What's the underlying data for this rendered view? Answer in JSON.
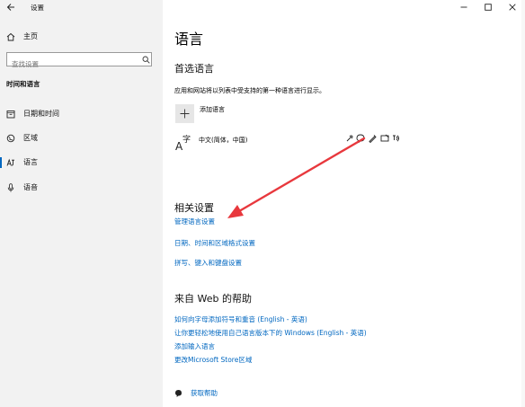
{
  "window": {
    "title": "设置",
    "back_icon": "back-arrow-icon",
    "minimize_icon": "minimize-icon",
    "maximize_icon": "maximize-icon",
    "close_icon": "close-icon"
  },
  "sidebar": {
    "home_label": "主页",
    "search_placeholder": "查找设置",
    "category": "时间和语言",
    "items": [
      {
        "label": "日期和时间",
        "icon": "calendar-icon",
        "selected": false
      },
      {
        "label": "区域",
        "icon": "globe-icon",
        "selected": false
      },
      {
        "label": "语言",
        "icon": "language-icon",
        "selected": true
      },
      {
        "label": "语音",
        "icon": "microphone-icon",
        "selected": false
      }
    ],
    "accent_color": "#0067c0"
  },
  "main": {
    "page_title": "语言",
    "preferred": {
      "title": "首选语言",
      "description": "应用和网站将以列表中受支持的第一种语言进行显示。",
      "add_label": "添加语言",
      "language_name": "中文(简体，中国)",
      "language_icon": "language-a-zi-icon",
      "feature_icons": [
        "speech-icon",
        "voice-icon",
        "handwriting-icon",
        "display-language-icon",
        "text-to-speech-icon"
      ]
    },
    "related": {
      "title": "相关设置",
      "links": [
        "管理语言设置",
        "日期、时间和区域格式设置",
        "拼写、键入和键盘设置"
      ]
    },
    "help": {
      "title": "来自 Web 的帮助",
      "links": [
        "如何向字母添加符号和重音 (English - 英语)",
        "让你更轻松地使用自己语言版本下的 Windows (English - 英语)",
        "添加输入语言",
        "更改Microsoft Store区域"
      ]
    },
    "get_help_label": "获取帮助",
    "annotation_color": "#e8383d"
  }
}
